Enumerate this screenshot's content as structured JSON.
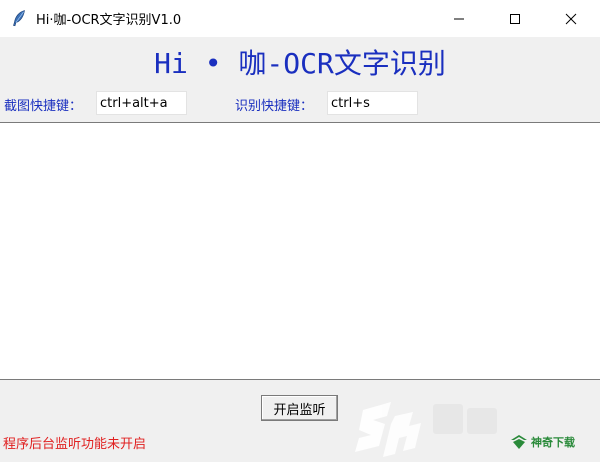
{
  "window": {
    "title": "Hi·咖-OCR文字识别V1.0",
    "icon": "feather-icon"
  },
  "header": {
    "title": "Hi • 咖-OCR文字识别"
  },
  "hotkeys": {
    "screenshot_label": "截图快捷键：",
    "screenshot_value": "ctrl+alt+a",
    "recognize_label": "识别快捷键：",
    "recognize_value": "ctrl+s"
  },
  "main": {
    "text_content": ""
  },
  "actions": {
    "start_listen_label": "开启监听"
  },
  "status": {
    "text": "程序后台监听功能未开启"
  },
  "watermark": {
    "brand_text": "神奇下载"
  },
  "colors": {
    "heading": "#1a2fbf",
    "status": "#e02020",
    "background": "#f0f0f0",
    "titlebar": "#ffffff"
  }
}
